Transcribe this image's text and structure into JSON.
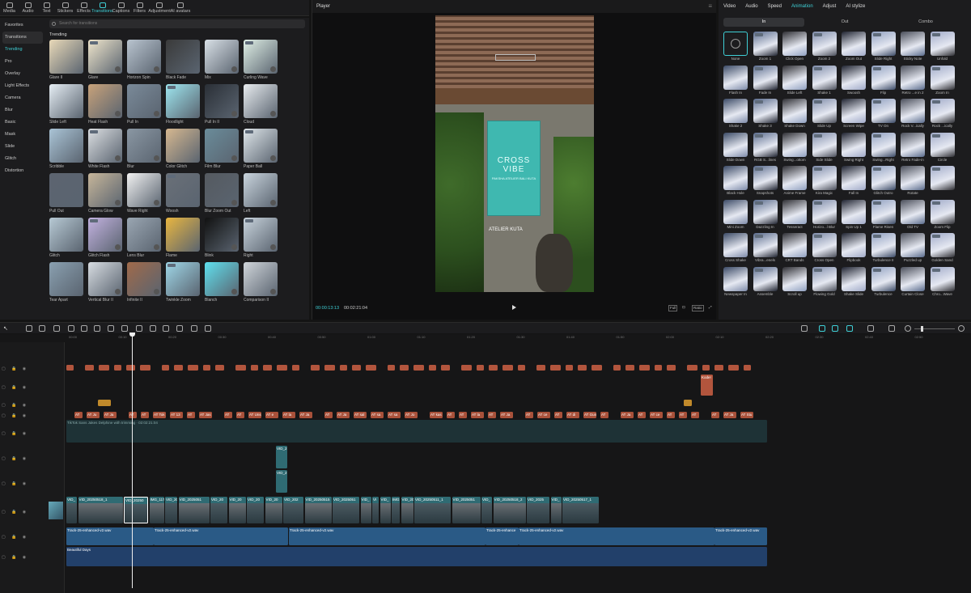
{
  "toolbar": {
    "items": [
      "Media",
      "Audio",
      "Text",
      "Stickers",
      "Effects",
      "Transitions",
      "Captions",
      "Filters",
      "Adjustment",
      "AI avatars"
    ],
    "active_index": 5
  },
  "sidebar": {
    "items": [
      "Favorites",
      "Transitions",
      "Trending",
      "Pro",
      "Overlay",
      "Light Effects",
      "Camera",
      "Blur",
      "Basic",
      "Mask",
      "Slide",
      "Glitch",
      "Distortion"
    ]
  },
  "search": {
    "placeholder": "Search for transitions"
  },
  "section_title": "Trending",
  "transitions": [
    "Glare II",
    "Glare",
    "Horizon Spin",
    "Black Fade",
    "Mix",
    "Curling Wave",
    "Slide Left",
    "Heat Flash",
    "Pull In",
    "Floodlight",
    "Pull In II",
    "Cloud",
    "Scribble",
    "White Flash",
    "Blur",
    "Color Glitch",
    "Film Blur",
    "Paper Ball",
    "Pull Out",
    "Camera Glow",
    "Wave Right",
    "Woosh",
    "Blur Zoom Out",
    "Left",
    "Glitch",
    "Glitch Flash",
    "Lens Blur",
    "Flame",
    "Blink",
    "Right",
    "Tear Apart",
    "Vertical Blur II",
    "Infinite II",
    "Twinkle Zoom",
    "Blanch",
    "Comparison II"
  ],
  "player": {
    "title": "Player",
    "current_time": "00:00:13:13",
    "total_time": "00:02:21:04",
    "buttons": [
      "Full",
      "Ratio"
    ],
    "video": {
      "sign_line1": "CROSS",
      "sign_line2": "VIBE",
      "sign_sub": "PAKSHA ATELIER BALI KUTA",
      "caption": "ATELIER KUTA"
    }
  },
  "right": {
    "tabs": [
      "Video",
      "Audio",
      "Speed",
      "Animation",
      "Adjust",
      "AI stylize"
    ],
    "active_tab": 3,
    "subtabs": [
      "In",
      "Out",
      "Combo"
    ],
    "animations": [
      "None",
      "Zoom 1",
      "Click Open",
      "Zoom 2",
      "Zoom Out",
      "Slide Right",
      "Sticky Note",
      "Unfold",
      "Flash In",
      "Fade In",
      "Slide Left",
      "Shake 1",
      "Swoosh",
      "Flip",
      "Retro ...e in 2",
      "Zoom In",
      "Shake 2",
      "Shake 3",
      "Shake Down",
      "Slide Up",
      "Screen Wipe",
      "TV On",
      "Rock V...ically",
      "Rock ...ically",
      "Slide Down",
      "RGB S...lines",
      "Swing...ottom",
      "Side Slide",
      "Swing Right",
      "Swing...Right",
      "Retro Fade-in",
      "Circle",
      "Black Hole",
      "Snapshots",
      "Anime Frame",
      "Kira Magic",
      "Fall In",
      "Glitch Outro",
      "Rotate",
      "",
      "Mini Zoom",
      "Dazzling In",
      "Tesseract",
      "Horizo...l Blur",
      "Spin Up 1",
      "Flame Risen",
      "Old TV",
      "Zoom Flip",
      "Cross Shake",
      "Vibra...enels",
      "CRT Bands",
      "Cross Open",
      "Flipbook",
      "Turbulence II",
      "Puzzled up",
      "Golden Sand",
      "Newspaper In",
      "Assemble",
      "Scroll up",
      "Flowing Gold",
      "Shake Slide",
      "Turbulence",
      "Curtain Close",
      "Chro...Wave"
    ]
  },
  "ruler": [
    "00:00",
    "00:10",
    "00:20",
    "00:30",
    "00:40",
    "00:50",
    "01:00",
    "01:10",
    "01:20",
    "01:30",
    "01:40",
    "01:50",
    "02:00",
    "02:10",
    "02:20",
    "02:30",
    "02:40",
    "02:50"
  ],
  "timeline": {
    "caption_clips": 56,
    "text_labels": [
      "AT",
      "AT Ju",
      "AT Ja",
      "AT",
      "AT",
      "AT Tok",
      "AT 13",
      "AT",
      "AT Jas",
      "AT",
      "AT",
      "AT Uns",
      "AT e",
      "AT la",
      "AT Ja",
      "AT",
      "AT Ja",
      "AT sal",
      "AT sa",
      "AT sa",
      "AT Jo",
      "AT kas",
      "AT",
      "AT",
      "AT la",
      "AT",
      "AT Ja",
      "AT",
      "AT ce",
      "AT",
      "AT di",
      "AT Gun",
      "AT",
      "AT Ja",
      "AT",
      "AT ce",
      "AT",
      "AT",
      "AT",
      "AT",
      "AT Ja",
      "AT Stu"
    ],
    "kodel_label": "Kode!",
    "long_clip_label": "TikTok Sans Jakes Delphine with trimming · 02:02:21:04",
    "vid_small": [
      "VID_2",
      "VID_2"
    ],
    "main_labels": [
      "VID_",
      "VID_20250518_1",
      "VID_20250",
      "IMG_117",
      "VID_20",
      "VID_2025051",
      "VID_20",
      "VID_20",
      "VID_20",
      "VID_20",
      "VID_202",
      "VID_20250515",
      "VID_2025051",
      "VID_",
      "VI",
      "VID_",
      "IMG",
      "VID_20",
      "VID_20250511_1",
      "VID_2025051",
      "VID_",
      "VID_20250518_2",
      "VID_2025",
      "VID_",
      "VID_20250517_1"
    ],
    "audio_labels": [
      "Track-25-enhanced-v2.wav",
      "Track-25-enhanced-v2.wav",
      "Track-25-enhanced-v2.wav",
      "Track-25-enhance",
      "Track-25-enhanced-v2.wav",
      "Track-25-enhanced-v2.wav"
    ],
    "music_label": "Beautiful Days"
  }
}
